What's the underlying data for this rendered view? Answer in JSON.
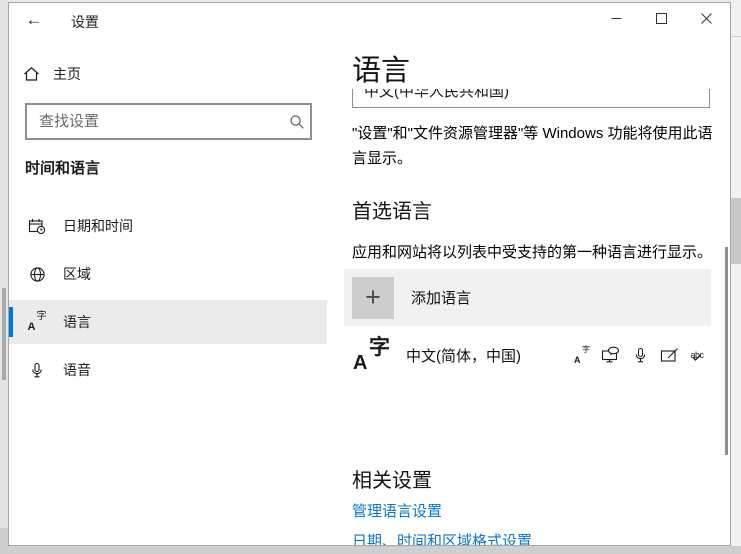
{
  "colors": {
    "accent": "#0078d7",
    "link": "#0b76cc",
    "add_row_bg": "#f1f1f1",
    "plus_square_bg": "#cdcdcd"
  },
  "glyphs": {
    "back_arrow": "←",
    "plus": "+",
    "abc": "abc"
  },
  "titlebar": {
    "app_title": "设置"
  },
  "sidebar": {
    "home": {
      "label": "主页"
    },
    "search": {
      "placeholder": "查找设置"
    },
    "section_header": "时间和语言",
    "items": [
      {
        "label": "日期和时间",
        "icon": "calendar-clock-icon",
        "selected": false
      },
      {
        "label": "区域",
        "icon": "globe-icon",
        "selected": false
      },
      {
        "label": "语言",
        "icon": "language-icon",
        "selected": true
      },
      {
        "label": "语音",
        "icon": "microphone-icon",
        "selected": false
      }
    ]
  },
  "main": {
    "page_title": "语言",
    "display_language_dropdown": {
      "value": "中文(中华人民共和国)"
    },
    "display_language_desc": "\"设置\"和\"文件资源管理器\"等 Windows 功能将使用此语言显示。",
    "preferred_section": {
      "title": "首选语言",
      "desc": "应用和网站将以列表中受支持的第一种语言进行显示。",
      "add_button": {
        "label": "添加语言",
        "icon": "plus-icon"
      },
      "languages": [
        {
          "name": "中文(简体，中国)",
          "capabilities": [
            "display-language-icon",
            "text-to-speech-icon",
            "speech-recognition-icon",
            "handwriting-icon",
            "basic-typing-icon"
          ]
        }
      ]
    },
    "related_section": {
      "title": "相关设置",
      "links": [
        "管理语言设置",
        "日期、时间和区域格式设置"
      ]
    }
  }
}
